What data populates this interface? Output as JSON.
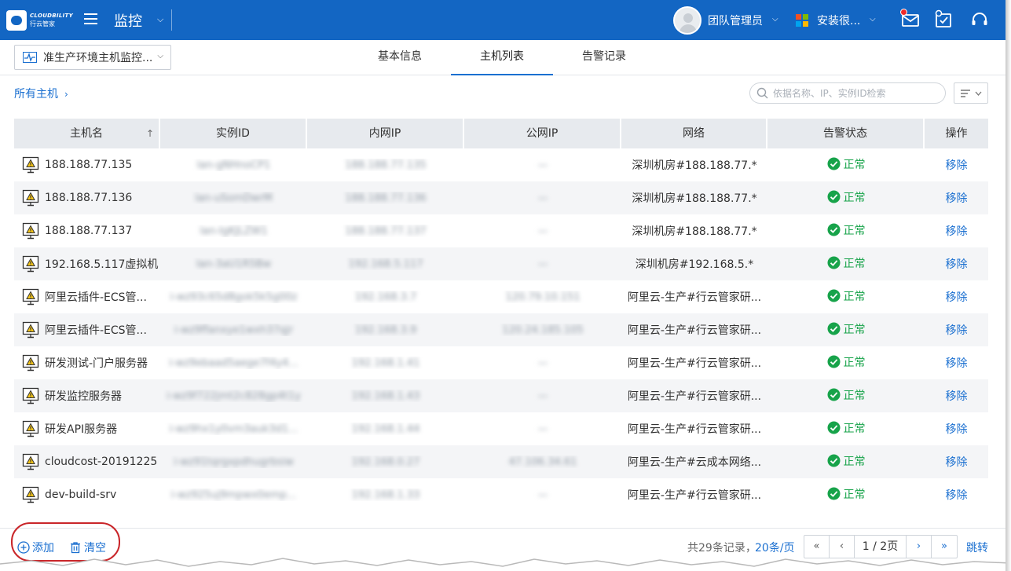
{
  "app": {
    "logo_en": "CLOUDBILITY",
    "logo_cn": "行云管家",
    "module_title": "监控"
  },
  "topbar": {
    "team_name": "团队管理员",
    "install_name": "安装很..."
  },
  "subheader": {
    "monitor_selected": "准生产环境主机监控...",
    "tabs": [
      {
        "label": "基本信息",
        "active": false
      },
      {
        "label": "主机列表",
        "active": true
      },
      {
        "label": "告警记录",
        "active": false
      }
    ]
  },
  "breadcrumb": {
    "root": "所有主机",
    "chevron": "›"
  },
  "search": {
    "placeholder": "依据名称、IP、实例ID检索"
  },
  "table": {
    "columns": [
      "主机名",
      "实例ID",
      "内网IP",
      "公网IP",
      "网络",
      "告警状态",
      "操作"
    ],
    "sort_indicator": "↑",
    "rows": [
      {
        "name": "188.188.77.135",
        "instance_id": "lan-gNHnoCP1",
        "private_ip": "188.188.77.135",
        "public_ip": "—",
        "network": "深圳机房#188.188.77.*",
        "status": "正常",
        "action": "移除"
      },
      {
        "name": "188.188.77.136",
        "instance_id": "lan-uSomDwrM",
        "private_ip": "188.188.77.136",
        "public_ip": "—",
        "network": "深圳机房#188.188.77.*",
        "status": "正常",
        "action": "移除"
      },
      {
        "name": "188.188.77.137",
        "instance_id": "lan-IgKJLZW1",
        "private_ip": "188.188.77.137",
        "public_ip": "—",
        "network": "深圳机房#188.188.77.*",
        "status": "正常",
        "action": "移除"
      },
      {
        "name": "192.168.5.117虚拟机",
        "instance_id": "lan-3aU1R5Bw",
        "private_ip": "192.168.5.117",
        "public_ip": "—",
        "network": "深圳机房#192.168.5.*",
        "status": "正常",
        "action": "移除"
      },
      {
        "name": "阿里云插件-ECS管...",
        "instance_id": "i-wz93c65d8gok5k5g00z",
        "private_ip": "192.168.3.7",
        "public_ip": "120.79.10.151",
        "network": "阿里云-生产#行云管家研...",
        "status": "正常",
        "action": "移除"
      },
      {
        "name": "阿里云插件-ECS管...",
        "instance_id": "i-wz9ffanxye1wxh37qjr",
        "private_ip": "192.168.3.9",
        "public_ip": "120.24.185.105",
        "network": "阿里云-生产#行云管家研...",
        "status": "正常",
        "action": "移除"
      },
      {
        "name": "研发测试-门户服务器",
        "instance_id": "i-wz9ebaad5aege7f4y4...",
        "private_ip": "192.168.1.41",
        "public_ip": "—",
        "network": "阿里云-生产#行云管家研...",
        "status": "正常",
        "action": "移除"
      },
      {
        "name": "研发监控服务器",
        "instance_id": "i-wz9f722jmt2c828gp4t1y",
        "private_ip": "192.168.1.43",
        "public_ip": "—",
        "network": "阿里云-生产#行云管家研...",
        "status": "正常",
        "action": "移除"
      },
      {
        "name": "研发API服务器",
        "instance_id": "i-wz9hx1y0vm3auk3d1...",
        "private_ip": "192.168.1.44",
        "public_ip": "—",
        "network": "阿里云-生产#行云管家研...",
        "status": "正常",
        "action": "移除"
      },
      {
        "name": "cloudcost-20191225",
        "instance_id": "i-wz91tqrgxpdhugrbsiw",
        "private_ip": "192.168.0.27",
        "public_ip": "47.106.34.61",
        "network": "阿里云-生产#云成本网络...",
        "status": "正常",
        "action": "移除"
      },
      {
        "name": "dev-build-srv",
        "instance_id": "i-wz925uj9mpwx0emp...",
        "private_ip": "192.168.1.33",
        "public_ip": "—",
        "network": "阿里云-生产#行云管家研...",
        "status": "正常",
        "action": "移除"
      }
    ]
  },
  "footer": {
    "add_label": "添加",
    "clear_label": "清空",
    "total_text": "共29条记录，",
    "per_page": "20条/页",
    "page_info": "1 / 2页",
    "first": "«",
    "prev": "‹",
    "next": "›",
    "last": "»",
    "jump_label": "跳转"
  },
  "colors": {
    "topbar": "#1366c3",
    "link": "#1a6fd0",
    "status_ok": "#17a34a",
    "highlight_ring": "#c9262a"
  },
  "icons": {
    "menu": "hamburger-icon",
    "monitor": "pulse-icon",
    "host": "monitor-warning-icon",
    "status": "check-circle-icon",
    "add": "plus-circle-icon",
    "clear": "trash-icon",
    "mail": "mail-icon",
    "task": "task-check-icon",
    "support": "headset-icon"
  }
}
